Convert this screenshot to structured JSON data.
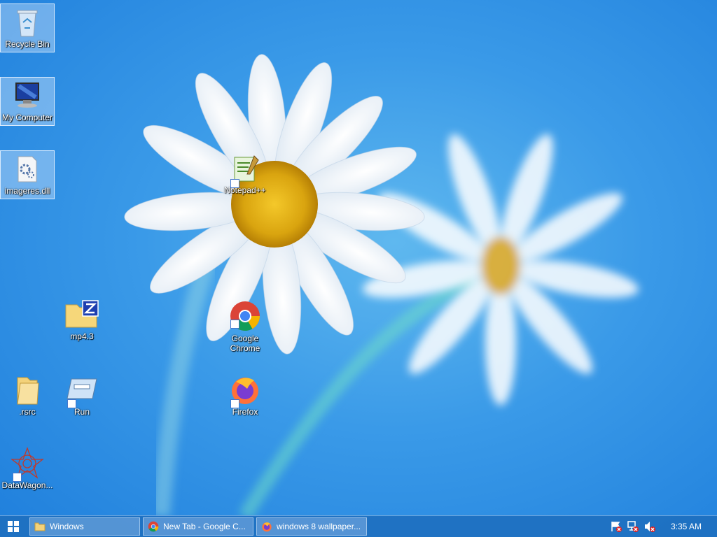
{
  "desktop": {
    "icons": [
      {
        "label": "Recycle Bin"
      },
      {
        "label": "My Computer"
      },
      {
        "label": "imageres.dll"
      },
      {
        "label": "Notepad++"
      },
      {
        "label": "mp4.3"
      },
      {
        "label": "Google Chrome"
      },
      {
        "label": ".rsrc"
      },
      {
        "label": "Run"
      },
      {
        "label": "Firefox"
      },
      {
        "label": "DataWagon..."
      }
    ]
  },
  "taskbar": {
    "buttons": [
      {
        "label": "Windows"
      },
      {
        "label": "New Tab - Google C..."
      },
      {
        "label": "windows 8 wallpaper..."
      }
    ],
    "clock": "3:35 AM"
  }
}
